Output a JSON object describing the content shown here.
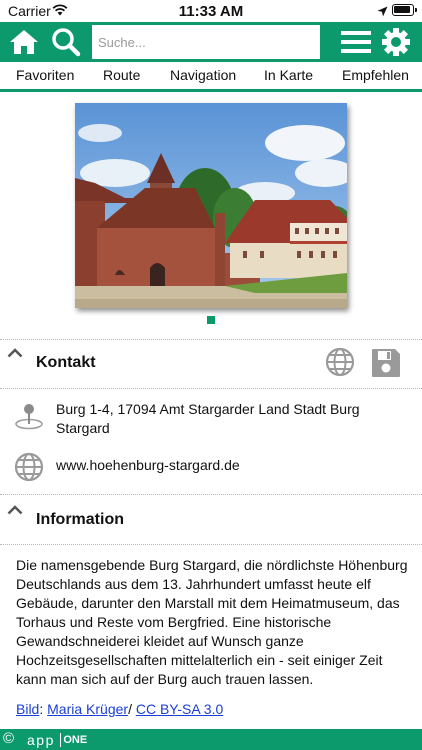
{
  "status_bar": {
    "carrier": "Carrier",
    "time": "11:33 AM"
  },
  "header": {
    "search_placeholder": "Suche..."
  },
  "tabs": [
    "Favoriten",
    "Route",
    "Navigation",
    "In Karte",
    "Empfehlen"
  ],
  "gallery": {
    "image_alt": "Burg Stargard",
    "page_count": 1,
    "current_page": 1
  },
  "contact": {
    "title": "Kontakt",
    "address": "Burg 1-4, 17094 Amt Stargarder Land Stadt Burg Stargard",
    "website": "www.hoehenburg-stargard.de"
  },
  "information": {
    "title": "Information",
    "text": "Die namensgebende Burg Stargard, die nördlichste Höhenburg Deutschlands aus dem 13. Jahrhundert umfasst heute elf Gebäude, darunter den Marstall mit dem Heimatmuseum, das Torhaus und Reste vom Bergfried. Eine historische Gewandschneiderei kleidet auf Wunsch ganze Hochzeitsgesellschaften mittelalterlich ein - seit einiger Zeit kann man sich auf der Burg auch trauen lassen.",
    "credit_label": "Bild",
    "credit_sep1": ": ",
    "credit_author": "Maria Krüger",
    "credit_sep2": "/ ",
    "credit_license": "CC BY-SA 3.0"
  },
  "footer": {
    "copyright": "©",
    "brand_a": "app",
    "brand_b": "ONE"
  },
  "colors": {
    "accent": "#0c9a6c",
    "link": "#1a3fd6",
    "icon_gray": "#9a9a9a"
  },
  "icons": [
    "wifi-icon",
    "location-arrow-icon",
    "battery-icon",
    "home-icon",
    "search-icon",
    "menu-icon",
    "gear-icon",
    "chevron-up-icon",
    "globe-icon",
    "save-icon",
    "map-pin-icon"
  ]
}
